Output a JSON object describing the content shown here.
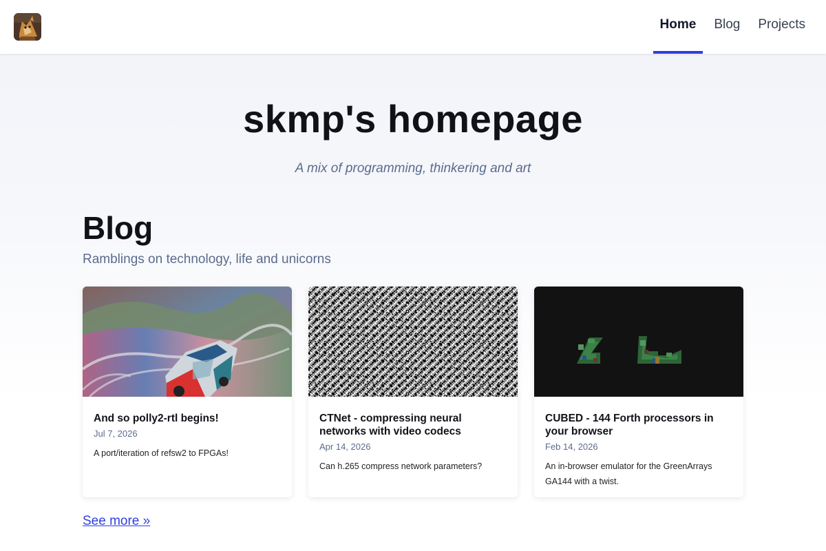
{
  "header": {
    "logo_icon": "avatar-fox-character-icon",
    "nav": [
      {
        "label": "Home",
        "active": true
      },
      {
        "label": "Blog",
        "active": false
      },
      {
        "label": "Projects",
        "active": false
      }
    ],
    "accent_color": "#2f3fe0"
  },
  "hero": {
    "title": "skmp's homepage",
    "tagline": "A mix of programming, thinkering and art"
  },
  "blog": {
    "title": "Blog",
    "subtitle": "Ramblings on technology, life and unicorns",
    "posts": [
      {
        "title": "And so polly2-rtl begins!",
        "date": "Jul 7, 2026",
        "description": "A port/iteration of refsw2 to FPGAs!",
        "image": "glitched-racing-car-render"
      },
      {
        "title": "CTNet - compressing neural networks with video codecs",
        "date": "Apr 14, 2026",
        "description": "Can h.265 compress network parameters?",
        "image": "black-and-white-noise"
      },
      {
        "title": "CUBED - 144 Forth processors in your browser",
        "date": "Feb 14, 2026",
        "description": "An in-browser emulator for the GreenArrays GA144 with a twist.",
        "image": "green-voxel-blocks-on-black"
      }
    ],
    "see_more_label": "See more »"
  }
}
